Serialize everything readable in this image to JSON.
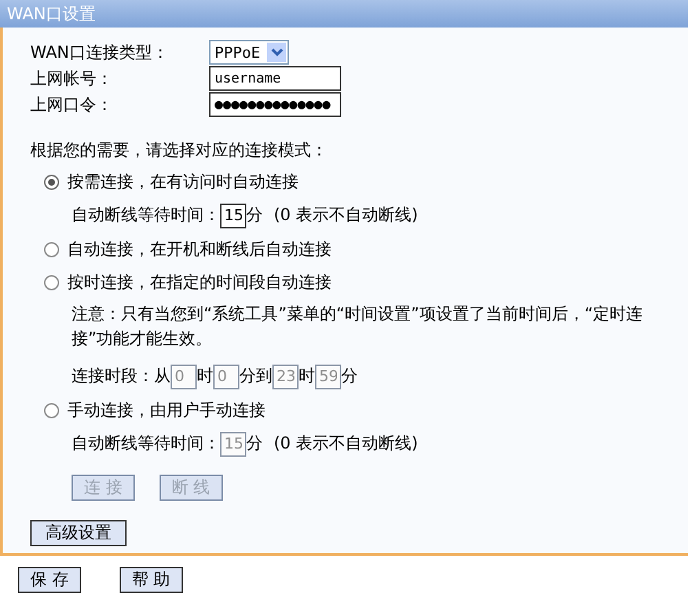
{
  "window": {
    "title": "WAN口设置"
  },
  "fields": [
    {
      "kind": "select",
      "label": "WAN口连接类型：",
      "value": "PPPoE"
    },
    {
      "kind": "text",
      "label": "上网帐号：",
      "value": "username"
    },
    {
      "kind": "text",
      "label": "上网口令：",
      "value": "●●●●●●●●●●●●●●"
    }
  ],
  "prompt": "根据您的需要，请选择对应的连接模式：",
  "modes": [
    {
      "label": "按需连接，在有访问时自动连接",
      "selected": true,
      "details": [
        {
          "kind": "inline",
          "parts": [
            {
              "kind": "text",
              "text": "自动断线等待时间："
            },
            {
              "kind": "input",
              "value": "15",
              "disabled": false
            },
            {
              "kind": "text",
              "text": "分"
            },
            {
              "kind": "text",
              "text": "(0 表示不自动断线)"
            }
          ]
        }
      ]
    },
    {
      "label": "自动连接，在开机和断线后自动连接",
      "selected": false
    },
    {
      "label": "按时连接，在指定的时间段自动连接",
      "selected": false,
      "details": [
        {
          "kind": "note",
          "text": "注意：只有当您到“系统工具”菜单的“时间设置”项设置了当前时间后，“定时连接”功能才能生效。"
        },
        {
          "kind": "inline",
          "parts": [
            {
              "kind": "text",
              "text": "连接时段：从"
            },
            {
              "kind": "input",
              "value": "0",
              "disabled": true
            },
            {
              "kind": "text",
              "text": "时"
            },
            {
              "kind": "input",
              "value": "0",
              "disabled": true
            },
            {
              "kind": "text",
              "text": "分到"
            },
            {
              "kind": "input",
              "value": "23",
              "disabled": true
            },
            {
              "kind": "text",
              "text": "时"
            },
            {
              "kind": "input",
              "value": "59",
              "disabled": true
            },
            {
              "kind": "text",
              "text": "分"
            }
          ]
        }
      ]
    },
    {
      "label": "手动连接，由用户手动连接",
      "selected": false,
      "details": [
        {
          "kind": "inline",
          "parts": [
            {
              "kind": "text",
              "text": "自动断线等待时间："
            },
            {
              "kind": "input",
              "value": "15",
              "disabled": true
            },
            {
              "kind": "text",
              "text": "分"
            },
            {
              "kind": "text",
              "text": "(0 表示不自动断线)"
            }
          ]
        },
        {
          "kind": "buttons",
          "buttons": [
            {
              "label": "连 接",
              "disabled": true
            },
            {
              "label": "断 线",
              "disabled": true
            }
          ]
        }
      ]
    }
  ],
  "advanced_button": "高级设置",
  "footer_buttons": [
    "保 存",
    "帮 助"
  ]
}
